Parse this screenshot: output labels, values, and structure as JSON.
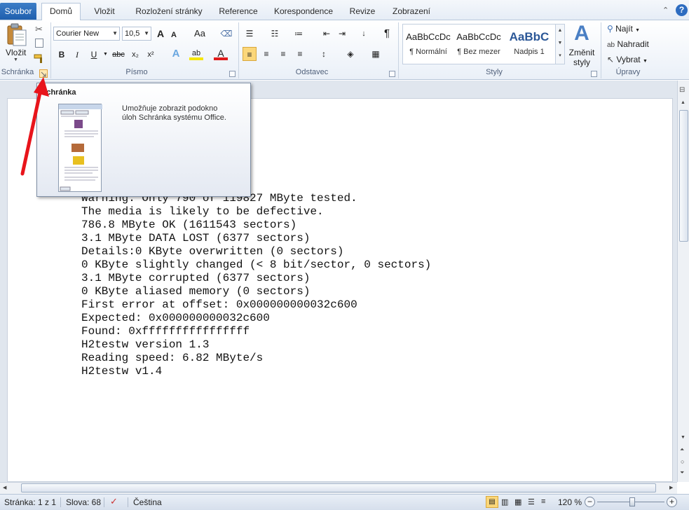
{
  "tabs": {
    "file": "Soubor",
    "items": [
      "Domů",
      "Vložit",
      "Rozložení stránky",
      "Reference",
      "Korespondence",
      "Revize",
      "Zobrazení"
    ]
  },
  "clipboard": {
    "paste_label": "Vložit",
    "group_label": "Schránka"
  },
  "font": {
    "name": "Courier New",
    "size": "10,5",
    "group_label": "Písmo",
    "grow_label": "A",
    "case_label": "Aa",
    "bold": "B",
    "italic": "I",
    "underline": "U",
    "strike": "abc",
    "sub": "x₂",
    "sup": "x²",
    "highlight": "ab",
    "color": "A"
  },
  "paragraph": {
    "group_label": "Odstavec"
  },
  "styles": {
    "group_label": "Styly",
    "items": [
      {
        "preview": "AaBbCcDc",
        "name": "¶ Normální"
      },
      {
        "preview": "AaBbCcDc",
        "name": "¶ Bez mezer"
      },
      {
        "preview": "AaBbC",
        "name": "Nadpis 1"
      }
    ],
    "change_styles": [
      "Změnit",
      "styly"
    ]
  },
  "editing": {
    "group_label": "Úpravy",
    "find": "Najít",
    "replace": "Nahradit",
    "select": "Vybrat"
  },
  "tooltip": {
    "title": "Schránka",
    "description_line1": "Umožňuje zobrazit podokno",
    "description_line2": "úloh Schránka systému Office."
  },
  "document": {
    "lines": [
      "Warning: Only 790 of 119827 MByte tested.",
      "The media is likely to be defective.",
      "786.8 MByte OK (1611543 sectors)",
      "3.1 MByte DATA LOST (6377 sectors)",
      "Details:0 KByte overwritten (0 sectors)",
      "0 KByte slightly changed (< 8 bit/sector, 0 sectors)",
      "3.1 MByte corrupted (6377 sectors)",
      "0 KByte aliased memory (0 sectors)",
      "First error at offset: 0x000000000032c600",
      "Expected: 0x000000000032c600",
      "Found: 0xffffffffffffffff",
      "H2testw version 1.3",
      "Reading speed: 6.82 MByte/s",
      "H2testw v1.4"
    ]
  },
  "status": {
    "page": "Stránka: 1 z 1",
    "words": "Slova: 68",
    "language": "Čeština",
    "zoom": "120 %",
    "zoom_minus": "−",
    "zoom_plus": "+"
  },
  "colors": {
    "accent": "#1f5fae",
    "annotation_arrow": "#e8141b",
    "font_color": "#e01b1b",
    "highlight": "#f5e600"
  }
}
